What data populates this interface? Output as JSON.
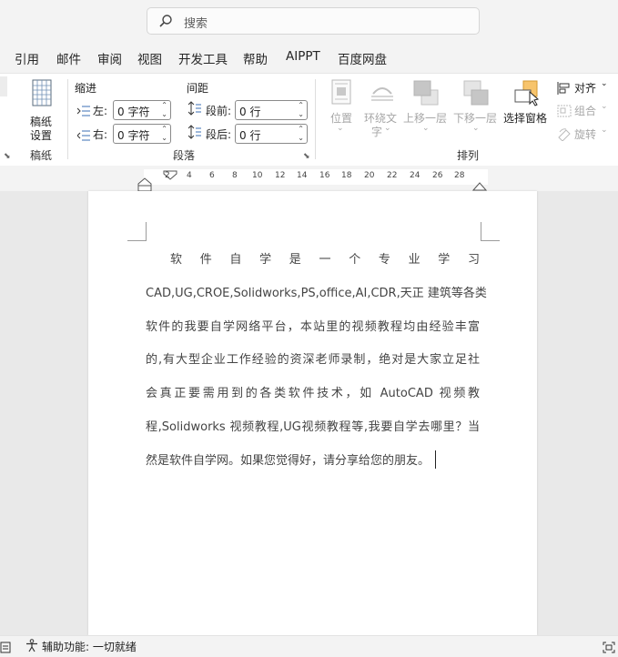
{
  "search": {
    "placeholder": "搜索"
  },
  "menu": [
    "引用",
    "邮件",
    "审阅",
    "视图",
    "开发工具",
    "帮助",
    "AIPPT",
    "百度网盘"
  ],
  "ribbon": {
    "manuscript": {
      "button_line1": "稿纸",
      "button_line2": "设置",
      "group": "稿纸"
    },
    "paragraph": {
      "indent_header": "缩进",
      "spacing_header": "间距",
      "left_label": "左:",
      "right_label": "右:",
      "before_label": "段前:",
      "after_label": "段后:",
      "left_value": "0 字符",
      "right_value": "0 字符",
      "before_value": "0 行",
      "after_value": "0 行",
      "group": "段落"
    },
    "arrange": {
      "position": "位置",
      "wrap_line1": "环绕文",
      "wrap_line2": "字",
      "bring_forward": "上移一层",
      "send_backward": "下移一层",
      "selection_pane": "选择窗格",
      "align": "对齐",
      "group_btn": "组合",
      "rotate": "旋转",
      "group": "排列"
    }
  },
  "ruler": {
    "ticks": [
      "2",
      "4",
      "6",
      "8",
      "10",
      "12",
      "14",
      "16",
      "18",
      "20",
      "22",
      "24",
      "26",
      "28"
    ]
  },
  "document": {
    "lines": [
      "软件自学是一个专业学习",
      "CAD,UG,CROE,Solidworks,PS,office,AI,CDR,天正 建筑等各类",
      "软件的我要自学网络平台，本站里的视频教程均由经验丰富",
      "的,有大型企业工作经验的资深老师录制，绝对是大家立足社",
      "会真正要需用到的各类软件技术，如 AutoCAD 视频教",
      "程,Solidworks 视频教程,UG视频教程等,我要自学去哪里？当",
      "然是软件自学网。如果您觉得好，请分享给您的朋友。"
    ]
  },
  "status": {
    "accessibility": "辅助功能: 一切就绪"
  },
  "colors": {
    "accent": "#f7c46c",
    "disabled": "#a7a7a7"
  }
}
